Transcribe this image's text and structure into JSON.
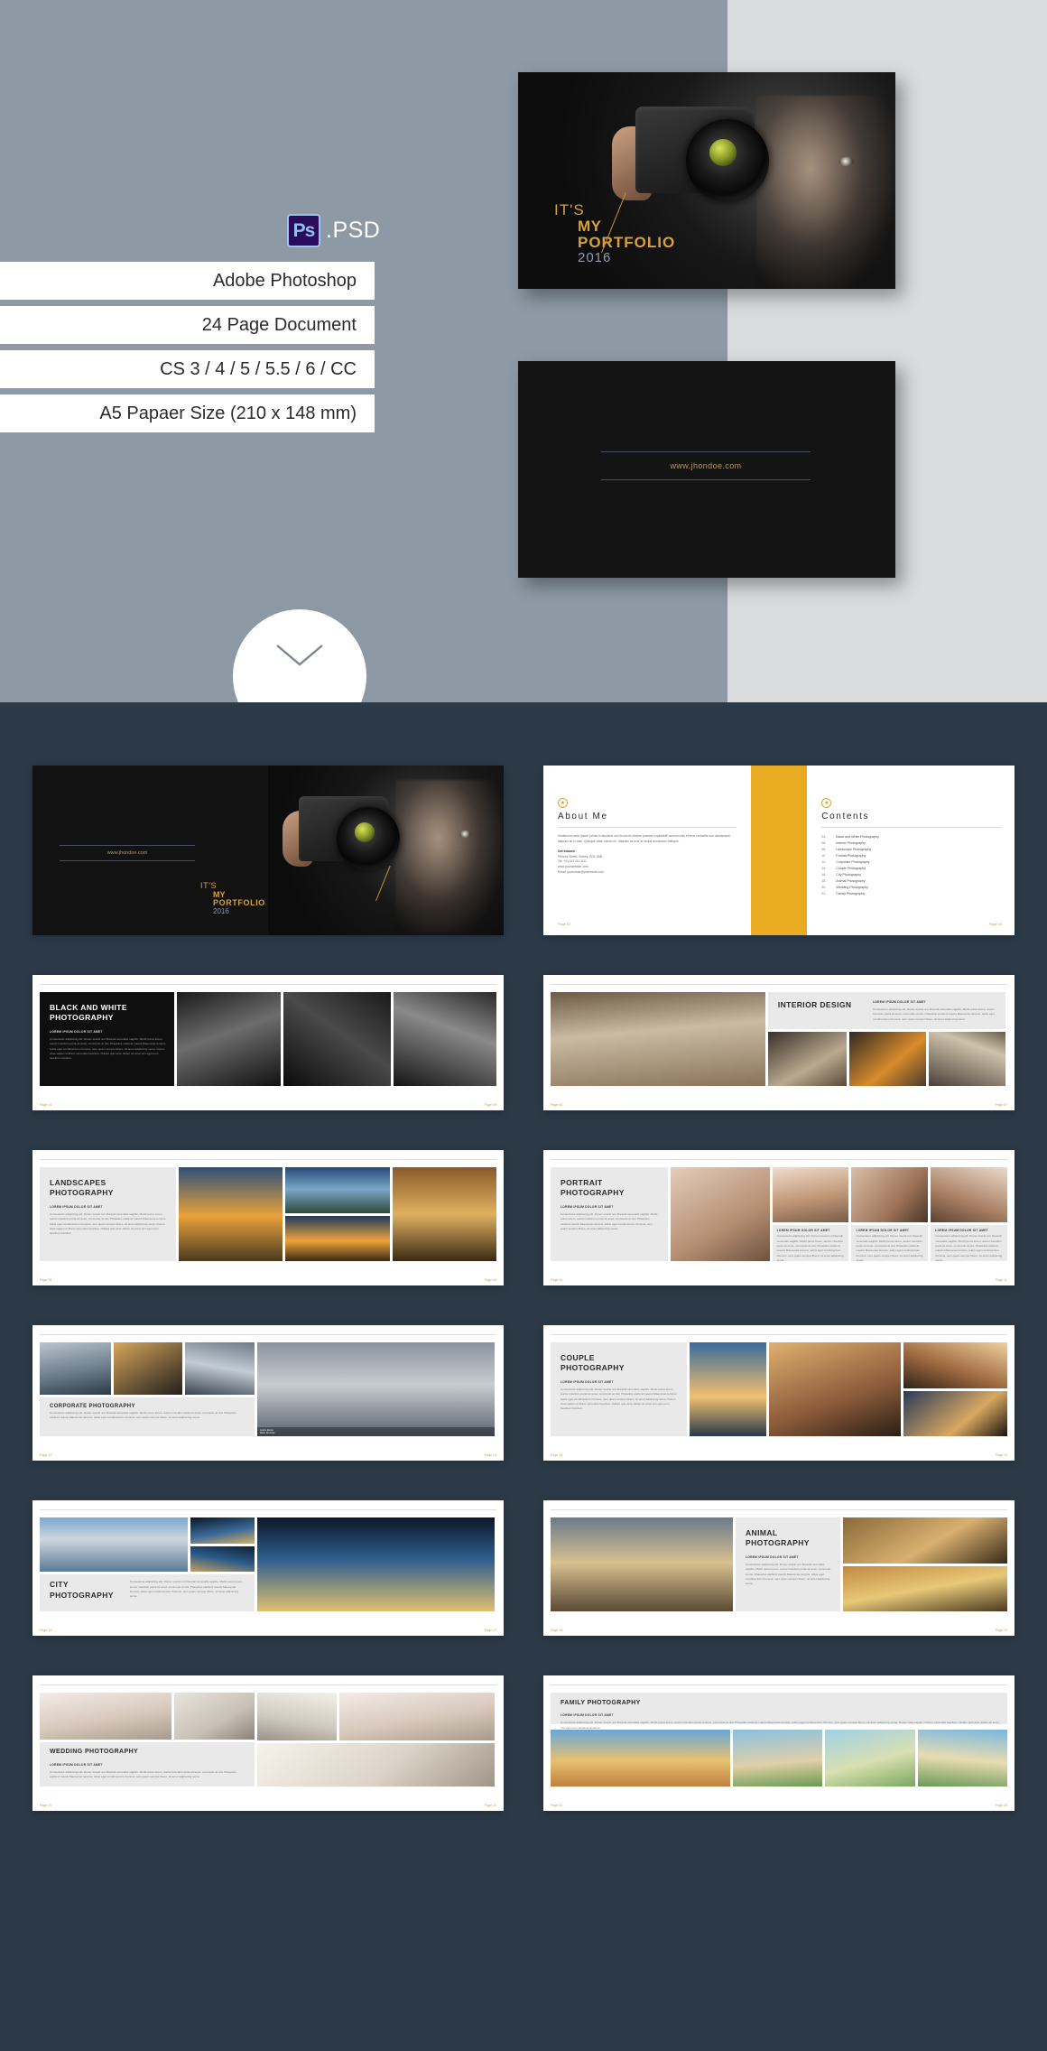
{
  "hero": {
    "psd_badge": "Ps",
    "psd_label": ".PSD",
    "specs": [
      "Adobe Photoshop",
      "24 Page Document",
      "CS 3 / 4 / 5 / 5.5 / 6 / CC",
      "A5 Papaer Size (210 x 148 mm)"
    ],
    "cover": {
      "line1": "IT'S",
      "line2": "MY",
      "line3": "PORTFOLIO",
      "year": "2016"
    },
    "back_cover_url": "www.jhondoe.com",
    "accent_gold": "#d9a233",
    "accent_blue": "#8e9bb5",
    "bg_left": "#8d99a5",
    "bg_right": "#d9dbdc"
  },
  "about": {
    "badge": "★",
    "heading": "About Me",
    "intro": "Vestibulum ante ipsum primis in faucibus orci luctus et ultrices posuere cupidubilli accuse cras et eros convallis rius ullamcorper aliquam sit in odio. Quisque vitae rutrum mi. Aliquam ac erat at neque accumsan tristique.",
    "contact_label": "Get Intouch :",
    "contact_lines": [
      "Princes Street, Sidney, SH1 3AB",
      "Tel: +01 111 111 1111",
      "www.yourwebsite.com",
      "Email: yourname@youremail.com"
    ],
    "page_left": "Page 02",
    "page_right": "Page 03"
  },
  "contents": {
    "badge": "★",
    "heading": "Contents",
    "items": [
      {
        "num": "04.",
        "label": "Black and White Photography"
      },
      {
        "num": "06.",
        "label": "Interior Photography"
      },
      {
        "num": "08.",
        "label": "Landscape Photography"
      },
      {
        "num": "10.",
        "label": "Portrait Photography"
      },
      {
        "num": "12.",
        "label": "Corporate Photography"
      },
      {
        "num": "14.",
        "label": "Couple Photography"
      },
      {
        "num": "16.",
        "label": "City Photography"
      },
      {
        "num": "18.",
        "label": "Animal Photography"
      },
      {
        "num": "20.",
        "label": "Wedding Photography"
      },
      {
        "num": "22.",
        "label": "Family Photography"
      }
    ]
  },
  "lorem": {
    "sub": "LOREM IPSUM DOLOR SIT AMET",
    "body": "Consectetur adipiscing elit. Donec sceral non libesrali venenatis sagittis. Morbi purus lorem, auctor interdum porta sit amet, commodo at nisi. Phasellus eleifend mauris Maecenas tempus, tellus eget condimentum rhoncus, sem quam semper libero, sit amet adipiscing sema. Donec vitae sapien ut libero venenatis faucibus. Nullam quis ante. Etiam sit amet orci eget eros faucibus tincidunt.",
    "body_short": "Consectetur adipiscing elit. Donec sceral non libesrali venenatis sagittis. Morbi purus lorem, auctor interdum porta sit amet, commodo at nisi. Phasellus eleifend mauris Maecenas tempus, tellus eget condimentum rhoncus, sem quam semper libero, sit amet adipiscing sema."
  },
  "spreads": [
    {
      "title": "BLACK AND WHITE\nPHOTOGRAPHY",
      "page_left": "Page 04",
      "page_right": "Page 05",
      "theme": "dark"
    },
    {
      "title": "INTERIOR DESIGN",
      "page_left": "Page 06",
      "page_right": "Page 07",
      "theme": "light"
    },
    {
      "title": "LANDSCAPES\nPHOTOGRAPHY",
      "page_left": "Page 08",
      "page_right": "Page 09",
      "theme": "light"
    },
    {
      "title": "PORTRAIT\nPHOTOGRAPHY",
      "page_left": "Page 10",
      "page_right": "Page 11",
      "theme": "light"
    },
    {
      "title": "CORPORATE PHOTOGRAPHY",
      "page_left": "Page 12",
      "page_right": "Page 13",
      "theme": "light"
    },
    {
      "title": "COUPLE\nPHOTOGRAPHY",
      "page_left": "Page 14",
      "page_right": "Page 15",
      "theme": "light"
    },
    {
      "title": "CITY\nPHOTOGRAPHY",
      "page_left": "Page 16",
      "page_right": "Page 17",
      "theme": "light"
    },
    {
      "title": "ANIMAL\nPHOTOGRAPHY",
      "page_left": "Page 18",
      "page_right": "Page 19",
      "theme": "light"
    },
    {
      "title": "WEDDING PHOTOGRAPHY",
      "page_left": "Page 20",
      "page_right": "Page 21",
      "theme": "light"
    },
    {
      "title": "FAMILY PHOTOGRAPHY",
      "page_left": "Page 22",
      "page_right": "Page 23",
      "theme": "light"
    }
  ],
  "captions": {
    "corp_a": "CORPORATE PHOTOGRAPHY",
    "corp_b": "Lorem Ipsum\nDolor Sit Amet",
    "lorem_cap": "LOREM IPSUM DOLOR SIT AMET"
  },
  "colors": {
    "page_bg": "#2c3a47",
    "yellow": "#e8ab22",
    "gold_text": "#c19f55"
  }
}
